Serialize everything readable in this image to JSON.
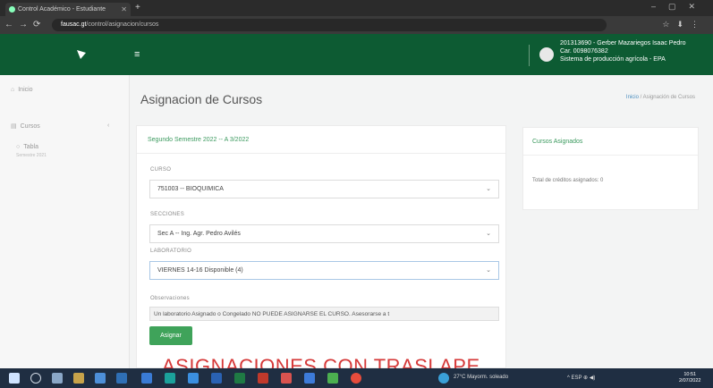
{
  "browser": {
    "tab_title": "Control Académico - Estudiante",
    "address_host": "fausac.gt",
    "address_path": "/control/asignacion/cursos"
  },
  "header": {
    "user_line1": "201313690 - Gerber Mazariegos Isaac Pedro",
    "user_line2": "Car. 0098076382",
    "user_line3": "Sistema de producción agrícola - EPA"
  },
  "sidebar": {
    "items": [
      {
        "icon": "home-icon",
        "label": "Inicio"
      },
      {
        "icon": "courses-icon",
        "label": "Cursos"
      },
      {
        "icon": "table-icon",
        "label": "Tabla",
        "sub": "Semestre 2021"
      }
    ]
  },
  "page": {
    "title": "Asignacion de Cursos",
    "breadcrumb_home": "Inicio",
    "breadcrumb_current": "Asignación de Cursos"
  },
  "form": {
    "card_title": "Segundo Semestre 2022 -- A 3/2022",
    "curso_label": "CURSO",
    "curso_value": "751003 -- BIOQUIMICA",
    "secciones_label": "SECCIONES",
    "secciones_value": "Sec A -- Ing. Agr. Pedro Avilés",
    "laboratorio_label": "LABORATORIO",
    "laboratorio_value": "VIERNES 14-16 Disponible (4)",
    "observaciones_label": "Observaciones",
    "observaciones_value": "Un laboratorio Asignado o Congelado NO PUEDE ASIGNARSE EL CURSO. Asesorarse a t",
    "submit_label": "Asignar"
  },
  "assigned": {
    "title": "Cursos Asignados",
    "total_text": "Total de créditos asignados: 0"
  },
  "caption": "ASIGNACIONES CON TRASLAPE",
  "taskbar": {
    "weather": "27°C Mayorm. soleado",
    "tray": "^ ESP ⊕ ◀)",
    "time": "10:51",
    "date": "2/07/2022"
  },
  "colors": {
    "header_green": "#0d5b33",
    "accent_green": "#3fa35a",
    "caption_red": "#d63a3a"
  }
}
